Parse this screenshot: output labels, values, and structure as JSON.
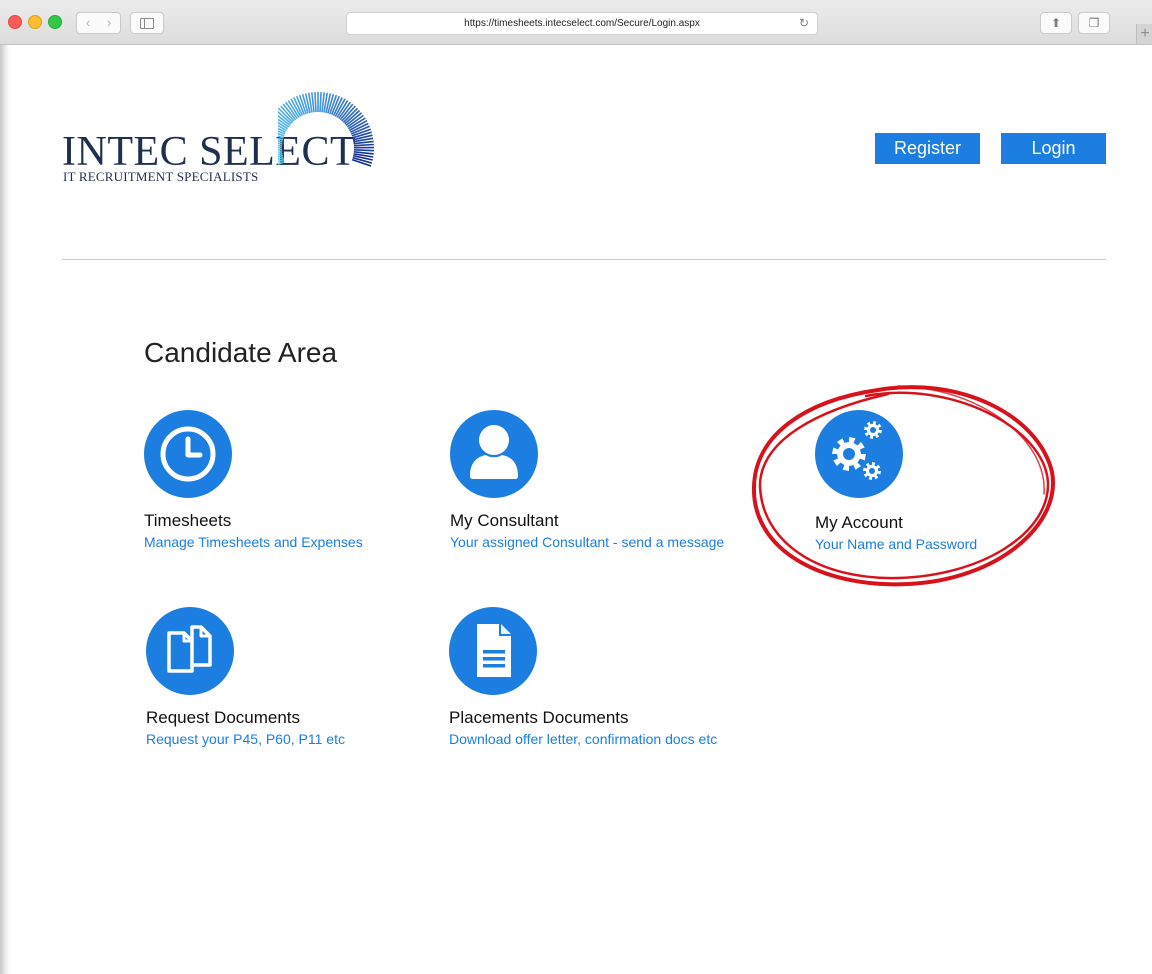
{
  "browser": {
    "url": "https://timesheets.intecselect.com/Secure/Login.aspx",
    "icons": [
      "chevron-left-icon",
      "chevron-right-icon",
      "sidebar-icon",
      "reload-icon",
      "share-icon",
      "tabs-icon",
      "plus-icon"
    ]
  },
  "header": {
    "logo_name": "INTEC SELECT",
    "logo_tagline": "IT RECRUITMENT SPECIALISTS",
    "register_label": "Register",
    "login_label": "Login"
  },
  "main": {
    "title": "Candidate Area",
    "tiles": [
      {
        "title": "Timesheets",
        "subtitle": "Manage Timesheets and Expenses",
        "icon": "clock-icon"
      },
      {
        "title": "My Consultant",
        "subtitle": "Your assigned Consultant - send a message",
        "icon": "person-icon"
      },
      {
        "title": "My Account",
        "subtitle": "Your Name and Password",
        "icon": "gears-icon"
      },
      {
        "title": "Request Documents",
        "subtitle": "Request your P45, P60, P11 etc",
        "icon": "documents-icon"
      },
      {
        "title": "Placements Documents",
        "subtitle": "Download offer letter, confirmation docs etc",
        "icon": "document-icon"
      }
    ]
  },
  "colors": {
    "accent": "#1b7ee0",
    "logo_text": "#1f2f4f",
    "annotation": "#d8121b"
  }
}
